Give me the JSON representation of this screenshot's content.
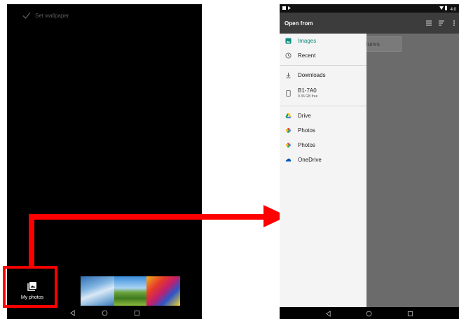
{
  "left_screen": {
    "set_wallpaper": "Set wallpaper",
    "my_photos": "My photos"
  },
  "right_screen": {
    "status_time": "4:0",
    "drawer_title": "Open from",
    "behind_chip": "tures",
    "drawer_items": [
      {
        "label": "Images",
        "icon": "image-icon"
      },
      {
        "label": "Recent",
        "icon": "clock-icon"
      },
      {
        "label": "Downloads",
        "icon": "download-icon"
      },
      {
        "label": "B1-7A0",
        "sub": "9.36 GB free",
        "icon": "tablet-icon"
      },
      {
        "label": "Drive",
        "icon": "google-drive-icon"
      },
      {
        "label": "Photos",
        "icon": "pinwheel-icon"
      },
      {
        "label": "Photos",
        "icon": "pinwheel-icon"
      },
      {
        "label": "OneDrive",
        "icon": "cloud-icon"
      }
    ]
  },
  "colors": {
    "highlight": "#ff0000",
    "selected_item": "#0f8a7e"
  }
}
